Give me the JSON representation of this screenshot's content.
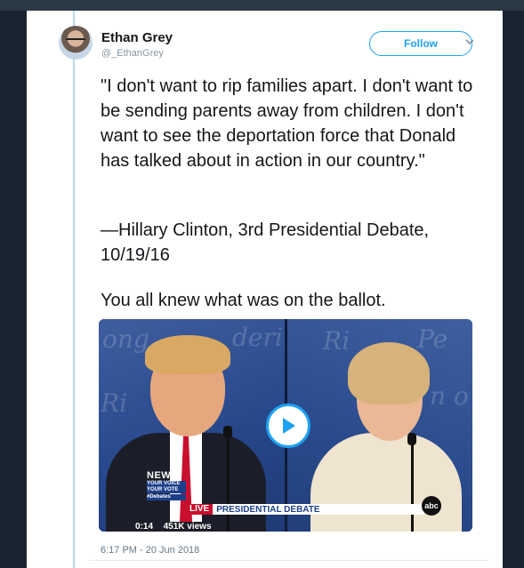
{
  "tweet": {
    "author_name": "Ethan Grey",
    "author_handle": "@_EthanGrey",
    "follow_label": "Follow",
    "text_paragraphs": [
      "\"I don't want to rip families apart. I don't want to be sending parents away from children. I don't want to see the deportation force that Donald has talked about in action in our country.\"",
      "—Hillary Clinton, 3rd Presidential Debate, 10/19/16",
      "You all knew what was on the ballot."
    ],
    "timestamp": "6:17 PM - 20 Jun 2018"
  },
  "video": {
    "duration": "0:14",
    "views": "451K views",
    "network_logo_text": "NEWS",
    "network_sub_text": "YOUR VOICE YOUR VOTE",
    "hashtag": "#Debates",
    "live_tag": "LIVE",
    "banner_text": "PRESIDENTIAL DEBATE",
    "channel_logo": "abc"
  },
  "colors": {
    "accent": "#1da1f2",
    "text": "#14171a",
    "muted": "#8a96a3"
  }
}
